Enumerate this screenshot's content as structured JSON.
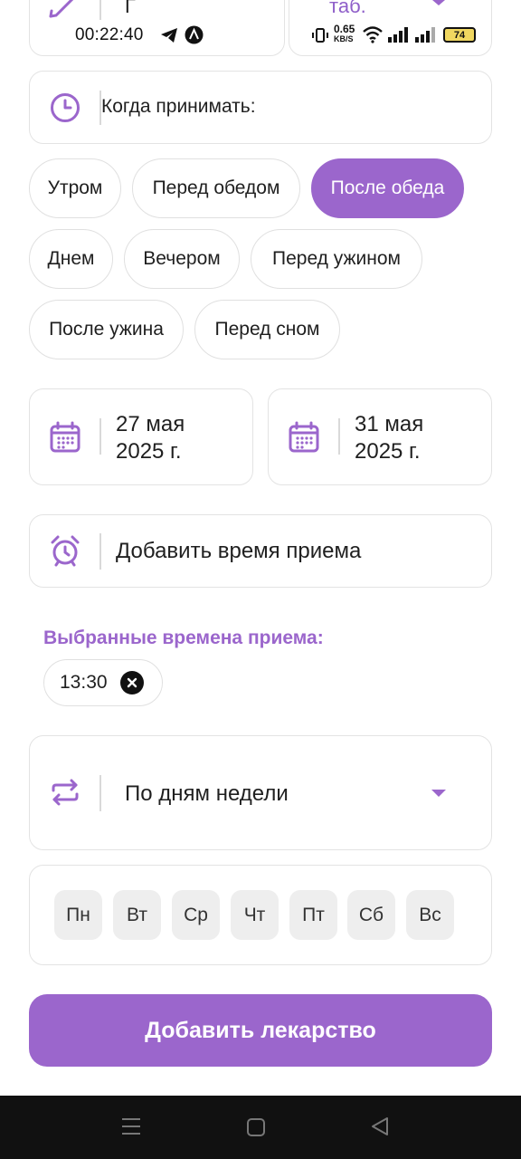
{
  "status_bar": {
    "time": "00:22:40",
    "net_speed_value": "0.65",
    "net_speed_unit": "KB/S",
    "battery": "74"
  },
  "top_fields": {
    "name_value": "Г",
    "form_value": "таб."
  },
  "when_field": {
    "label": "Когда принимать:"
  },
  "chips": [
    {
      "label": "Утром",
      "selected": false
    },
    {
      "label": "Перед обедом",
      "selected": false
    },
    {
      "label": "После обеда",
      "selected": true
    },
    {
      "label": "Днем",
      "selected": false
    },
    {
      "label": "Вечером",
      "selected": false
    },
    {
      "label": "Перед ужином",
      "selected": false
    },
    {
      "label": "После ужина",
      "selected": false
    },
    {
      "label": "Перед сном",
      "selected": false
    }
  ],
  "dates": {
    "start_line1": "27 мая",
    "start_line2": "2025 г.",
    "end_line1": "31 мая",
    "end_line2": "2025 г."
  },
  "add_time": {
    "label": "Добавить время приема"
  },
  "selected_times": {
    "title": "Выбранные времена приема:",
    "items": [
      "13:30"
    ]
  },
  "frequency": {
    "value": "По дням недели"
  },
  "week_days": [
    "Пн",
    "Вт",
    "Ср",
    "Чт",
    "Пт",
    "Сб",
    "Вс"
  ],
  "submit": {
    "label": "Добавить лекарство"
  },
  "colors": {
    "accent": "#9b66cc",
    "chip_border": "#e0e0e0",
    "day_bg": "#eeeeee",
    "navbar": "#111111"
  }
}
